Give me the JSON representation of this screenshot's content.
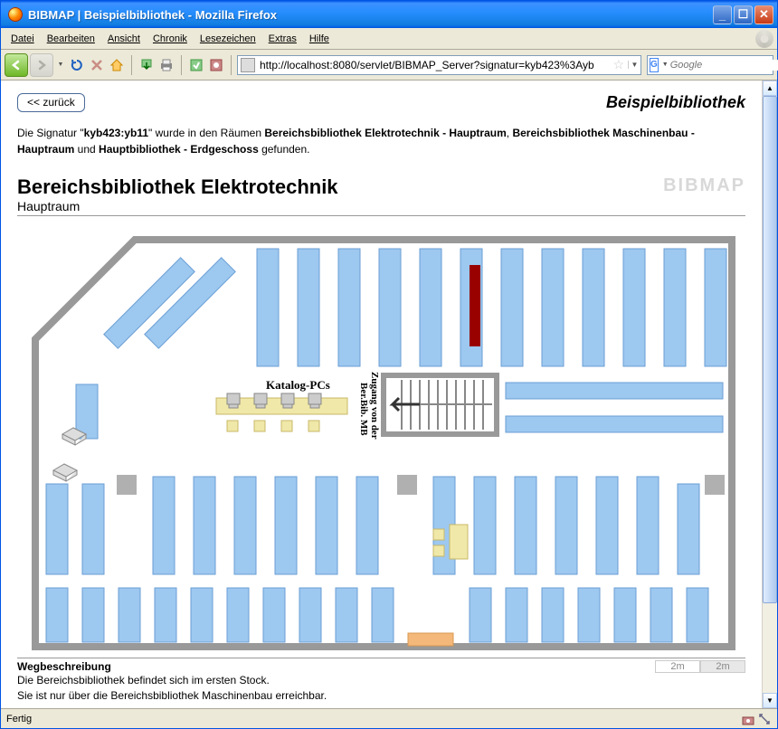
{
  "window": {
    "title": "BIBMAP | Beispielbibliothek - Mozilla Firefox"
  },
  "menu": {
    "items": [
      "Datei",
      "Bearbeiten",
      "Ansicht",
      "Chronik",
      "Lesezeichen",
      "Extras",
      "Hilfe"
    ]
  },
  "toolbar": {
    "url": "http://localhost:8080/servlet/BIBMAP_Server?signatur=kyb423%3Ayb",
    "search_placeholder": "Google"
  },
  "page": {
    "back_label": "<< zurück",
    "library_name": "Beispielbibliothek",
    "info": {
      "prefix": "Die Signatur \"",
      "signature": "kyb423:yb11",
      "mid1": "\" wurde in den Räumen ",
      "room1": "Bereichsbibliothek Elektrotechnik - Hauptraum",
      "mid2": ", ",
      "room2": "Bereichsbibliothek Maschinenbau - Hauptraum",
      "mid3": " und ",
      "room3": "Hauptbibliothek - Erdgeschoss",
      "suffix": " gefunden."
    },
    "map": {
      "title": "Bereichsbibliothek Elektrotechnik",
      "subtitle": "Hauptraum",
      "logo": "BIBMAP",
      "katalog_label": "Katalog-PCs",
      "access_label": "Zugang von der Ber.Bib. MB"
    },
    "desc": {
      "title": "Wegbeschreibung",
      "line1": "Die Bereichsbibliothek befindet sich im ersten Stock.",
      "line2": "Sie ist nur über die Bereichsbibliothek Maschinenbau erreichbar.",
      "scale": "2m"
    }
  },
  "status": {
    "text": "Fertig"
  }
}
